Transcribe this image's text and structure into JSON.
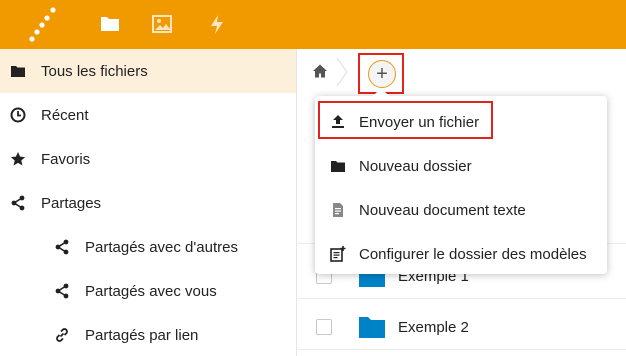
{
  "header": {
    "accent_color": "#f09a00",
    "apps": [
      {
        "name": "files",
        "icon": "folder-icon"
      },
      {
        "name": "photos",
        "icon": "image-icon"
      },
      {
        "name": "activity",
        "icon": "lightning-icon"
      }
    ]
  },
  "sidebar": {
    "items": [
      {
        "label": "Tous les fichiers",
        "icon": "folder-icon",
        "active": true
      },
      {
        "label": "Récent",
        "icon": "clock-icon"
      },
      {
        "label": "Favoris",
        "icon": "star-icon"
      },
      {
        "label": "Partages",
        "icon": "share-icon"
      },
      {
        "label": "Partagés avec d'autres",
        "icon": "share-icon"
      },
      {
        "label": "Partagés avec vous",
        "icon": "share-icon"
      },
      {
        "label": "Partagés par lien",
        "icon": "link-icon"
      }
    ]
  },
  "breadcrumb": {
    "add_label": "+"
  },
  "new_menu": {
    "items": [
      {
        "label": "Envoyer un fichier",
        "icon": "upload-icon"
      },
      {
        "label": "Nouveau dossier",
        "icon": "folder-icon"
      },
      {
        "label": "Nouveau document texte",
        "icon": "text-document-icon"
      },
      {
        "label": "Configurer le dossier des modèles",
        "icon": "template-icon"
      }
    ]
  },
  "files": {
    "rows": [
      {
        "name": "Exemple 1",
        "type": "folder"
      },
      {
        "name": "Exemple 2",
        "type": "folder"
      }
    ],
    "folder_color": "#0082c9"
  }
}
